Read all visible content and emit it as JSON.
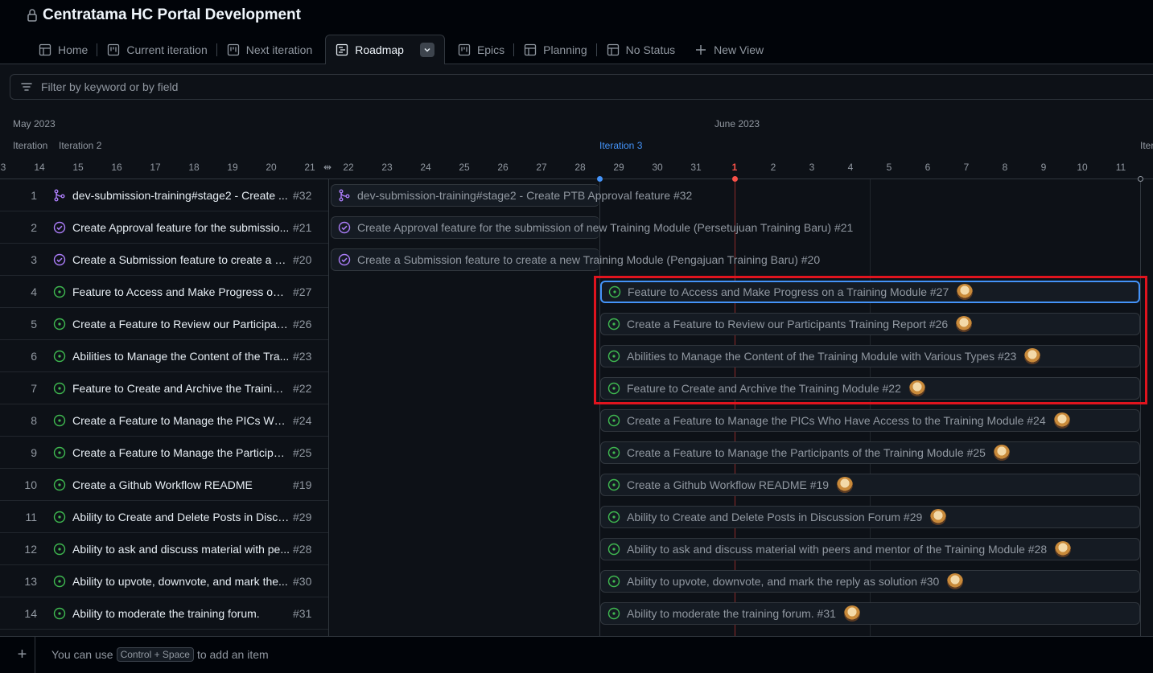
{
  "project": {
    "title": "Centratama HC Portal Development"
  },
  "tabs": [
    {
      "label": "Home",
      "icon": "table-icon"
    },
    {
      "label": "Current iteration",
      "icon": "board-icon"
    },
    {
      "label": "Next iteration",
      "icon": "board-icon"
    },
    {
      "label": "Roadmap",
      "icon": "roadmap-icon",
      "active": true
    },
    {
      "label": "Epics",
      "icon": "board-icon"
    },
    {
      "label": "Planning",
      "icon": "table-icon"
    },
    {
      "label": "No Status",
      "icon": "table-icon"
    },
    {
      "label": "New View",
      "icon": "plus-icon"
    }
  ],
  "filter": {
    "placeholder": "Filter by keyword or by field"
  },
  "timeline": {
    "months": [
      "May 2023",
      "June 2023"
    ],
    "iterations": [
      "Iteration",
      "Iteration 2",
      "Iteration 3",
      "Iter"
    ],
    "days": [
      "3",
      "14",
      "15",
      "16",
      "17",
      "18",
      "19",
      "20",
      "21",
      "22",
      "23",
      "24",
      "25",
      "26",
      "27",
      "28",
      "29",
      "30",
      "31",
      "1",
      "2",
      "3",
      "4",
      "5",
      "6",
      "7",
      "8",
      "9",
      "10",
      "11"
    ],
    "today": "1"
  },
  "rows": [
    {
      "num": "1",
      "title": "dev-submission-training#stage2 - Create ...",
      "ref": "#32",
      "status": "merged",
      "bar": "dev-submission-training#stage2 - Create PTB Approval feature #32"
    },
    {
      "num": "2",
      "title": "Create Approval feature for the submissio...",
      "ref": "#21",
      "status": "done",
      "bar": "Create Approval feature for the submission of new Training Module (Persetujuan Training Baru) #21"
    },
    {
      "num": "3",
      "title": "Create a Submission feature to create a ne...",
      "ref": "#20",
      "status": "done",
      "bar": "Create a Submission feature to create a new Training Module (Pengajuan Training Baru) #20"
    },
    {
      "num": "4",
      "title": "Feature to Access and Make Progress on a...",
      "ref": "#27",
      "status": "open",
      "bar": "Feature to Access and Make Progress on a Training Module #27"
    },
    {
      "num": "5",
      "title": "Create a Feature to Review our Participant...",
      "ref": "#26",
      "status": "open",
      "bar": "Create a Feature to Review our Participants Training Report #26"
    },
    {
      "num": "6",
      "title": "Abilities to Manage the Content of the Tra...",
      "ref": "#23",
      "status": "open",
      "bar": "Abilities to Manage the Content of the Training Module with Various Types #23"
    },
    {
      "num": "7",
      "title": "Feature to Create and Archive the Training...",
      "ref": "#22",
      "status": "open",
      "bar": "Feature to Create and Archive the Training Module #22"
    },
    {
      "num": "8",
      "title": "Create a Feature to Manage the PICs Who...",
      "ref": "#24",
      "status": "open",
      "bar": "Create a Feature to Manage the PICs Who Have Access to the Training Module #24"
    },
    {
      "num": "9",
      "title": "Create a Feature to Manage the Participan...",
      "ref": "#25",
      "status": "open",
      "bar": "Create a Feature to Manage the Participants of the Training Module #25"
    },
    {
      "num": "10",
      "title": "Create a Github Workflow README",
      "ref": "#19",
      "status": "open",
      "bar": "Create a Github Workflow README #19"
    },
    {
      "num": "11",
      "title": "Ability to Create and Delete Posts in Discu...",
      "ref": "#29",
      "status": "open",
      "bar": "Ability to Create and Delete Posts in Discussion Forum #29"
    },
    {
      "num": "12",
      "title": "Ability to ask and discuss material with pe...",
      "ref": "#28",
      "status": "open",
      "bar": "Ability to ask and discuss material with peers and mentor of the Training Module #28"
    },
    {
      "num": "13",
      "title": "Ability to upvote, downvote, and mark the...",
      "ref": "#30",
      "status": "open",
      "bar": "Ability to upvote, downvote, and mark the reply as solution #30"
    },
    {
      "num": "14",
      "title": "Ability to moderate the training forum.",
      "ref": "#31",
      "status": "open",
      "bar": "Ability to moderate the training forum. #31"
    }
  ],
  "footer": {
    "pre": "You can use",
    "kbd": "Control + Space",
    "post": "to add an item"
  },
  "colors": {
    "open": "#3fb950",
    "done": "#ab7df8",
    "merged": "#ab7df8",
    "today": "#f85149",
    "accent": "#4493f8"
  }
}
